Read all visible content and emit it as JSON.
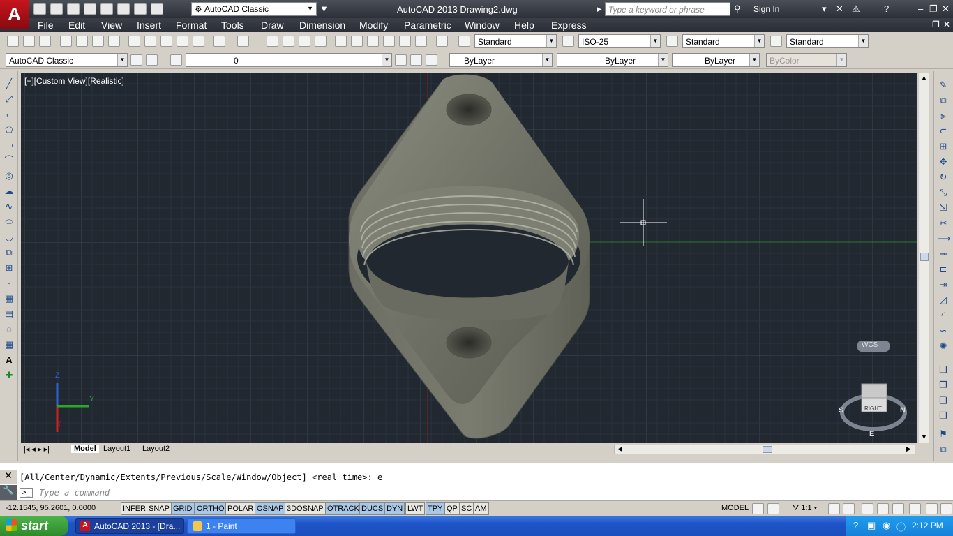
{
  "app": {
    "title": "AutoCAD 2013   Drawing2.dwg",
    "logo": "A"
  },
  "quick_access": {
    "workspace": "AutoCAD Classic",
    "icons": [
      "new-icon",
      "open-icon",
      "save-icon",
      "saveas-icon",
      "plot-icon",
      "print-icon",
      "undo-icon",
      "redo-icon"
    ]
  },
  "search": {
    "placeholder": "Type a keyword or phrase"
  },
  "account": {
    "sign_in": "Sign In"
  },
  "menus": [
    "File",
    "Edit",
    "View",
    "Insert",
    "Format",
    "Tools",
    "Draw",
    "Dimension",
    "Modify",
    "Parametric",
    "Window",
    "Help",
    "Express"
  ],
  "styles": {
    "text_style": "Standard",
    "dim_style": "ISO-25",
    "table_style": "Standard",
    "mleader_style": "Standard"
  },
  "layers": {
    "workspace": "AutoCAD Classic",
    "current_layer": "0"
  },
  "properties": {
    "color": "ByLayer",
    "linetype": "ByLayer",
    "lineweight": "ByLayer",
    "plot_style": "ByColor"
  },
  "viewport": {
    "label": "[−][Custom View][Realistic]",
    "wcs": "WCS",
    "viewcube_face": "RIGHT",
    "compass": {
      "s": "S",
      "n": "N",
      "e": "E"
    },
    "ucs": {
      "x": "X",
      "y": "Y",
      "z": "Z"
    }
  },
  "layout_tabs": [
    "Model",
    "Layout1",
    "Layout2"
  ],
  "command": {
    "history": "[All/Center/Dynamic/Extents/Previous/Scale/Window/Object] <real time>: e",
    "placeholder": "Type a command"
  },
  "status": {
    "coords": "-12.1545, 95.2601, 0.0000",
    "toggles": [
      {
        "label": "INFER",
        "on": false
      },
      {
        "label": "SNAP",
        "on": false
      },
      {
        "label": "GRID",
        "on": true
      },
      {
        "label": "ORTHO",
        "on": true
      },
      {
        "label": "POLAR",
        "on": false
      },
      {
        "label": "OSNAP",
        "on": true
      },
      {
        "label": "3DOSNAP",
        "on": false
      },
      {
        "label": "OTRACK",
        "on": true
      },
      {
        "label": "DUCS",
        "on": true
      },
      {
        "label": "DYN",
        "on": true
      },
      {
        "label": "LWT",
        "on": false
      },
      {
        "label": "TPY",
        "on": true
      },
      {
        "label": "QP",
        "on": false
      },
      {
        "label": "SC",
        "on": false
      },
      {
        "label": "AM",
        "on": false
      }
    ],
    "space": "MODEL",
    "annotation_scale": "1:1"
  },
  "taskbar": {
    "start": "start",
    "items": [
      "AutoCAD 2013 - [Dra...",
      "1 - Paint"
    ],
    "clock": "2:12 PM"
  }
}
